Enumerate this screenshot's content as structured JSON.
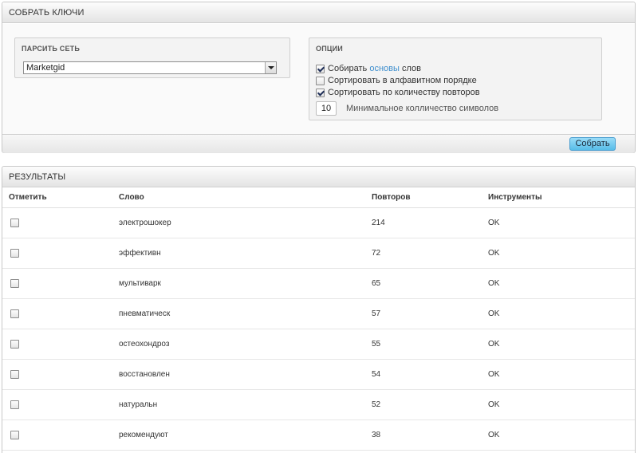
{
  "collect_panel": {
    "title": "СОБРАТЬ КЛЮЧИ",
    "parse_network": {
      "label": "ПАРСИТЬ СЕТЬ",
      "selected": "Marketgid"
    },
    "options": {
      "label": "ОПЦИИ",
      "collect_roots": {
        "prefix": "Собирать ",
        "link": "основы",
        "suffix": " слов",
        "checked": true
      },
      "sort_alpha": {
        "label": "Сортировать в алфавитном порядке",
        "checked": false
      },
      "sort_repeats": {
        "label": "Сортировать по количеству повторов",
        "checked": true
      },
      "min_chars": {
        "value": "10",
        "label": "Минимальное колличество символов"
      }
    },
    "submit_label": "Собрать"
  },
  "results_panel": {
    "title": "РЕЗУЛЬТАТЫ",
    "columns": [
      "Отметить",
      "Слово",
      "Повторов",
      "Инструменты"
    ],
    "rows": [
      {
        "word": "электрошокер",
        "repeats": "214",
        "tools": "OK"
      },
      {
        "word": "эффективн",
        "repeats": "72",
        "tools": "OK"
      },
      {
        "word": "мультиварк",
        "repeats": "65",
        "tools": "OK"
      },
      {
        "word": "пневматическ",
        "repeats": "57",
        "tools": "OK"
      },
      {
        "word": "остеохондроз",
        "repeats": "55",
        "tools": "OK"
      },
      {
        "word": "восстановлен",
        "repeats": "54",
        "tools": "OK"
      },
      {
        "word": "натуральн",
        "repeats": "52",
        "tools": "OK"
      },
      {
        "word": "рекомендуют",
        "repeats": "38",
        "tools": "OK"
      }
    ]
  },
  "colors": {
    "accent_button": "#57bde9",
    "link": "#3f8fce"
  }
}
